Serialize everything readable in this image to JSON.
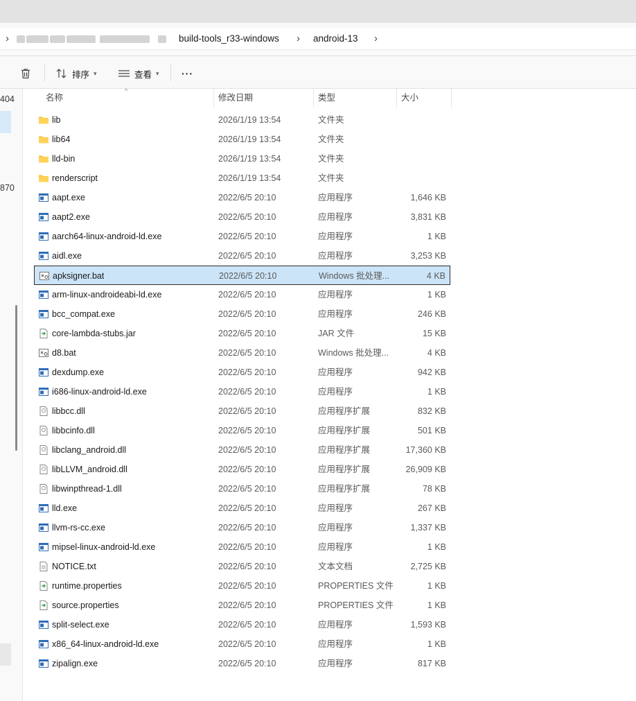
{
  "breadcrumb": {
    "chevron_first": "›",
    "segments": [
      "build-tools_r33-windows",
      "android-13"
    ],
    "chevrons": [
      "›",
      "›"
    ]
  },
  "toolbar": {
    "sort_label": "排序",
    "view_label": "查看",
    "more_label": "···"
  },
  "left_pane": {
    "truncated_top": "404",
    "truncated_mid": "870"
  },
  "columns": {
    "name": "名称",
    "date": "修改日期",
    "type": "类型",
    "size": "大小"
  },
  "files": [
    {
      "name": "lib",
      "date": "2026/1/19 13:54",
      "type": "文件夹",
      "size": "",
      "icon": "folder"
    },
    {
      "name": "lib64",
      "date": "2026/1/19 13:54",
      "type": "文件夹",
      "size": "",
      "icon": "folder"
    },
    {
      "name": "lld-bin",
      "date": "2026/1/19 13:54",
      "type": "文件夹",
      "size": "",
      "icon": "folder"
    },
    {
      "name": "renderscript",
      "date": "2026/1/19 13:54",
      "type": "文件夹",
      "size": "",
      "icon": "folder"
    },
    {
      "name": "aapt.exe",
      "date": "2022/6/5 20:10",
      "type": "应用程序",
      "size": "1,646 KB",
      "icon": "exe"
    },
    {
      "name": "aapt2.exe",
      "date": "2022/6/5 20:10",
      "type": "应用程序",
      "size": "3,831 KB",
      "icon": "exe"
    },
    {
      "name": "aarch64-linux-android-ld.exe",
      "date": "2022/6/5 20:10",
      "type": "应用程序",
      "size": "1 KB",
      "icon": "exe"
    },
    {
      "name": "aidl.exe",
      "date": "2022/6/5 20:10",
      "type": "应用程序",
      "size": "3,253 KB",
      "icon": "exe"
    },
    {
      "name": "apksigner.bat",
      "date": "2022/6/5 20:10",
      "type": "Windows 批处理...",
      "size": "4 KB",
      "icon": "bat",
      "selected": true
    },
    {
      "name": "arm-linux-androideabi-ld.exe",
      "date": "2022/6/5 20:10",
      "type": "应用程序",
      "size": "1 KB",
      "icon": "exe"
    },
    {
      "name": "bcc_compat.exe",
      "date": "2022/6/5 20:10",
      "type": "应用程序",
      "size": "246 KB",
      "icon": "exe"
    },
    {
      "name": "core-lambda-stubs.jar",
      "date": "2022/6/5 20:10",
      "type": "JAR 文件",
      "size": "15 KB",
      "icon": "jar"
    },
    {
      "name": "d8.bat",
      "date": "2022/6/5 20:10",
      "type": "Windows 批处理...",
      "size": "4 KB",
      "icon": "bat"
    },
    {
      "name": "dexdump.exe",
      "date": "2022/6/5 20:10",
      "type": "应用程序",
      "size": "942 KB",
      "icon": "exe"
    },
    {
      "name": "i686-linux-android-ld.exe",
      "date": "2022/6/5 20:10",
      "type": "应用程序",
      "size": "1 KB",
      "icon": "exe"
    },
    {
      "name": "libbcc.dll",
      "date": "2022/6/5 20:10",
      "type": "应用程序扩展",
      "size": "832 KB",
      "icon": "dll"
    },
    {
      "name": "libbcinfo.dll",
      "date": "2022/6/5 20:10",
      "type": "应用程序扩展",
      "size": "501 KB",
      "icon": "dll"
    },
    {
      "name": "libclang_android.dll",
      "date": "2022/6/5 20:10",
      "type": "应用程序扩展",
      "size": "17,360 KB",
      "icon": "dll"
    },
    {
      "name": "libLLVM_android.dll",
      "date": "2022/6/5 20:10",
      "type": "应用程序扩展",
      "size": "26,909 KB",
      "icon": "dll"
    },
    {
      "name": "libwinpthread-1.dll",
      "date": "2022/6/5 20:10",
      "type": "应用程序扩展",
      "size": "78 KB",
      "icon": "dll"
    },
    {
      "name": "lld.exe",
      "date": "2022/6/5 20:10",
      "type": "应用程序",
      "size": "267 KB",
      "icon": "exe"
    },
    {
      "name": "llvm-rs-cc.exe",
      "date": "2022/6/5 20:10",
      "type": "应用程序",
      "size": "1,337 KB",
      "icon": "exe"
    },
    {
      "name": "mipsel-linux-android-ld.exe",
      "date": "2022/6/5 20:10",
      "type": "应用程序",
      "size": "1 KB",
      "icon": "exe"
    },
    {
      "name": "NOTICE.txt",
      "date": "2022/6/5 20:10",
      "type": "文本文档",
      "size": "2,725 KB",
      "icon": "txt"
    },
    {
      "name": "runtime.properties",
      "date": "2022/6/5 20:10",
      "type": "PROPERTIES 文件",
      "size": "1 KB",
      "icon": "properties"
    },
    {
      "name": "source.properties",
      "date": "2022/6/5 20:10",
      "type": "PROPERTIES 文件",
      "size": "1 KB",
      "icon": "properties"
    },
    {
      "name": "split-select.exe",
      "date": "2022/6/5 20:10",
      "type": "应用程序",
      "size": "1,593 KB",
      "icon": "exe"
    },
    {
      "name": "x86_64-linux-android-ld.exe",
      "date": "2022/6/5 20:10",
      "type": "应用程序",
      "size": "1 KB",
      "icon": "exe"
    },
    {
      "name": "zipalign.exe",
      "date": "2022/6/5 20:10",
      "type": "应用程序",
      "size": "817 KB",
      "icon": "exe"
    }
  ],
  "colors": {
    "selection_bg": "#cce4f7",
    "folder": "#f8c542",
    "exe_blue": "#2f6db5"
  }
}
